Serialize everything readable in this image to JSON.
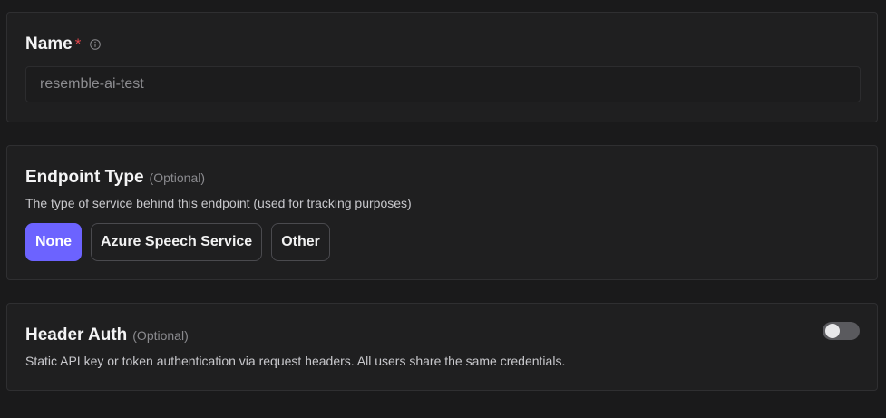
{
  "name_section": {
    "title": "Name",
    "required_marker": "*",
    "input_value": "resemble-ai-test"
  },
  "endpoint_section": {
    "title": "Endpoint Type",
    "optional_label": "(Optional)",
    "description": "The type of service behind this endpoint (used for tracking purposes)",
    "options": [
      "None",
      "Azure Speech Service",
      "Other"
    ],
    "selected": "None"
  },
  "auth_section": {
    "title": "Header Auth",
    "optional_label": "(Optional)",
    "description": "Static API key or token authentication via request headers. All users share the same credentials.",
    "enabled": false
  },
  "colors": {
    "accent": "#6c63ff",
    "required": "#e5484d",
    "background": "#1a1a1b",
    "card": "#1f1f20"
  }
}
